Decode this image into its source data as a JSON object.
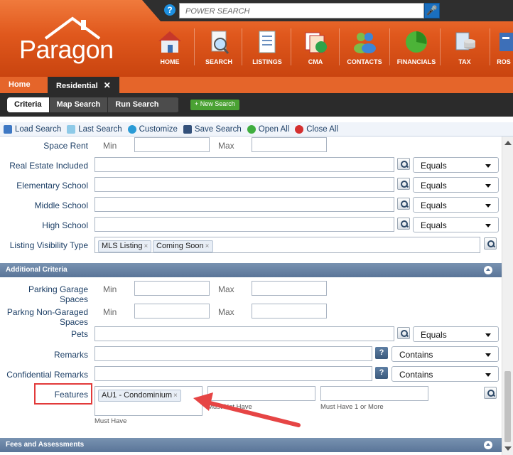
{
  "header": {
    "power_search_placeholder": "POWER SEARCH",
    "help_label": "?",
    "logo_text": "Paragon",
    "nav": [
      "HOME",
      "SEARCH",
      "LISTINGS",
      "CMA",
      "CONTACTS",
      "FINANCIALS",
      "TAX",
      "ROS"
    ]
  },
  "tabs": {
    "home": "Home",
    "residential": "Residential",
    "close": "✕"
  },
  "subnav": {
    "criteria": "Criteria",
    "map_search": "Map Search",
    "run_search": "Run Search",
    "new_search": "+ New Search"
  },
  "toolbar": [
    "Load Search",
    "Last Search",
    "Customize",
    "Save Search",
    "Open All",
    "Close All"
  ],
  "form": {
    "space_rent": {
      "label": "Space Rent",
      "min": "Min",
      "max": "Max"
    },
    "real_estate_included": {
      "label": "Real Estate Included",
      "op": "Equals"
    },
    "elementary_school": {
      "label": "Elementary School",
      "op": "Equals"
    },
    "middle_school": {
      "label": "Middle School",
      "op": "Equals"
    },
    "high_school": {
      "label": "High School",
      "op": "Equals"
    },
    "listing_visibility": {
      "label": "Listing Visibility Type",
      "tags": [
        "MLS Listing",
        "Coming Soon"
      ]
    },
    "additional_criteria": "Additional Criteria",
    "parking_garage": {
      "label1": "Parking Garage",
      "label2": "Spaces",
      "min": "Min",
      "max": "Max"
    },
    "parking_non_garaged": {
      "label1": "Parkng Non-Garaged",
      "label2": "Spaces",
      "min": "Min",
      "max": "Max"
    },
    "pets": {
      "label": "Pets",
      "op": "Equals"
    },
    "remarks": {
      "label": "Remarks",
      "op": "Contains",
      "help": "?"
    },
    "confidential_remarks": {
      "label": "Confidential Remarks",
      "op": "Contains",
      "help": "?"
    },
    "features": {
      "label": "Features",
      "tag": "AU1 - Condominium",
      "must_have": "Must Have",
      "must_not_have": "Must Not Have",
      "must_have_one": "Must Have 1 or More"
    },
    "fees_assessments": "Fees and Assessments",
    "tag_remove": "×"
  }
}
